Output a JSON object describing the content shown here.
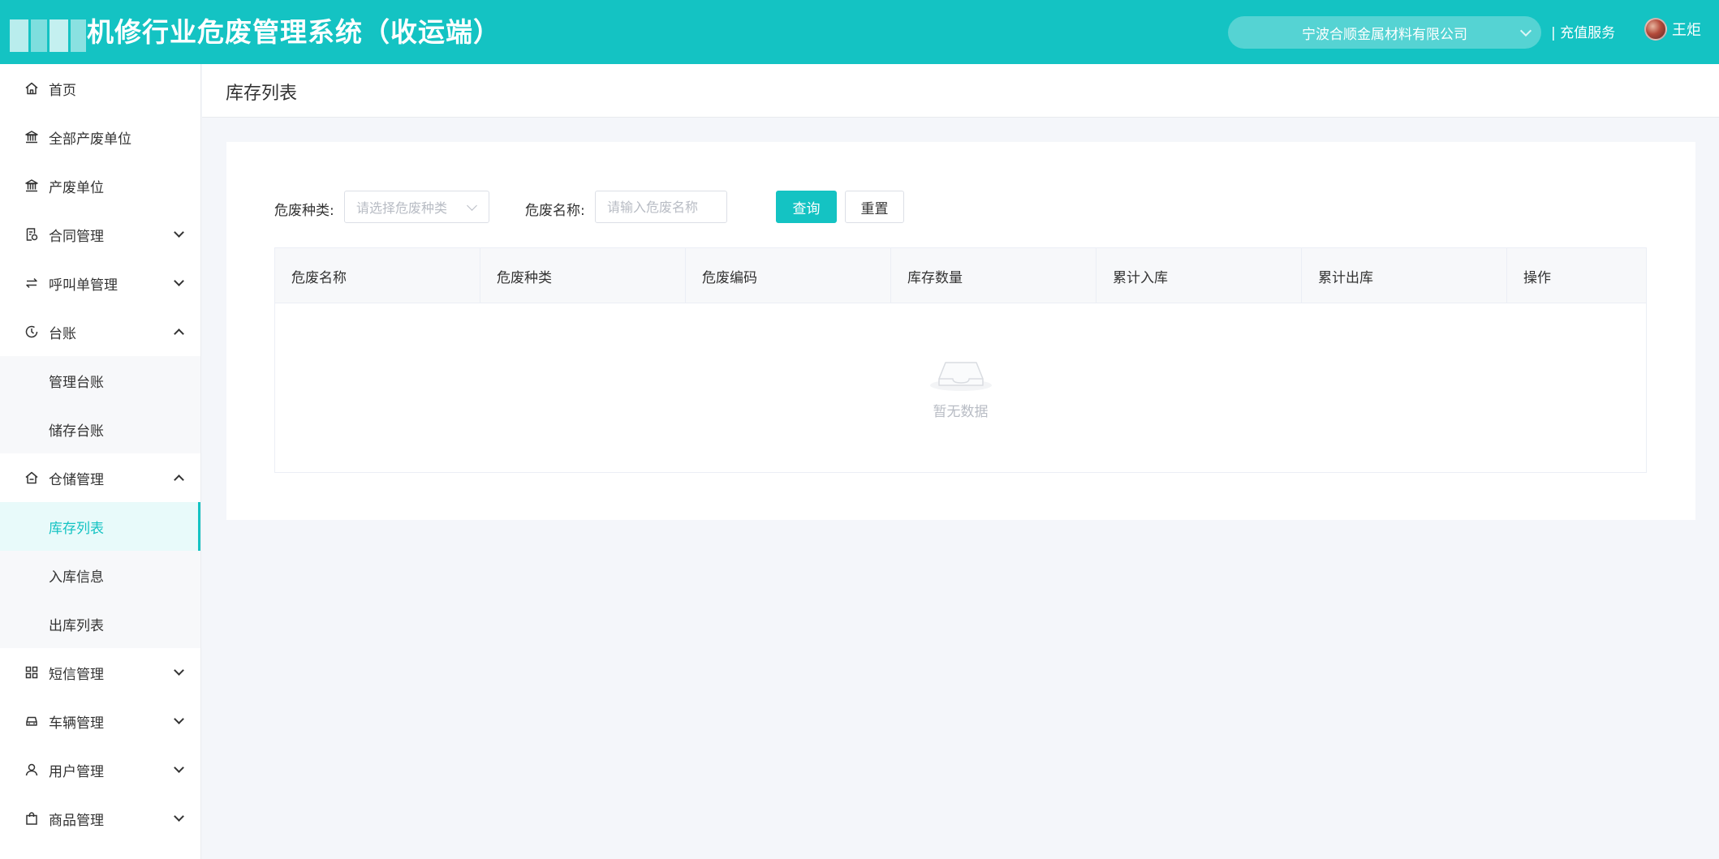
{
  "header": {
    "title": "机修行业危废管理系统（收运端）",
    "company": "宁波合顺金属材料有限公司",
    "recharge": "| 充值服务",
    "username": "王炬"
  },
  "sidebar": {
    "items": [
      {
        "label": "首页",
        "icon": "home-icon"
      },
      {
        "label": "全部产废单位",
        "icon": "bank-icon"
      },
      {
        "label": "产废单位",
        "icon": "bank-icon"
      },
      {
        "label": "合同管理",
        "icon": "contract-icon"
      },
      {
        "label": "呼叫单管理",
        "icon": "swap-icon"
      },
      {
        "label": "台账",
        "icon": "clock-icon"
      },
      {
        "label": "管理台账"
      },
      {
        "label": "储存台账"
      },
      {
        "label": "仓储管理",
        "icon": "warehouse-icon"
      },
      {
        "label": "库存列表"
      },
      {
        "label": "入库信息"
      },
      {
        "label": "出库列表"
      },
      {
        "label": "短信管理",
        "icon": "grid-icon"
      },
      {
        "label": "车辆管理",
        "icon": "car-icon"
      },
      {
        "label": "用户管理",
        "icon": "user-icon"
      },
      {
        "label": "商品管理",
        "icon": "bag-icon"
      }
    ]
  },
  "page": {
    "title": "库存列表"
  },
  "filters": {
    "type_label": "危废种类:",
    "type_placeholder": "请选择危废种类",
    "name_label": "危废名称:",
    "name_placeholder": "请输入危废名称",
    "query_label": "查询",
    "reset_label": "重置"
  },
  "table": {
    "columns": [
      "危废名称",
      "危废种类",
      "危废编码",
      "库存数量",
      "累计入库",
      "累计出库",
      "操作"
    ],
    "empty_text": "暂无数据"
  },
  "colors": {
    "accent": "#14c3c3"
  }
}
